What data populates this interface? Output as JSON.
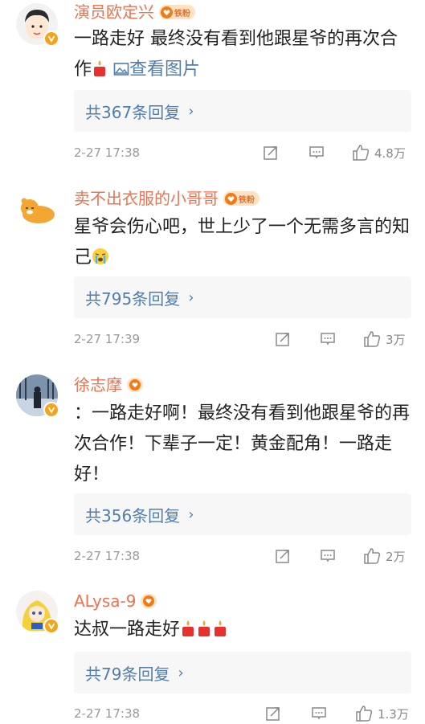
{
  "comments": [
    {
      "username": "演员欧定兴",
      "fan_badge": "铁粉",
      "verified": true,
      "text": "一路走好 最终没有看到他跟星爷的再次合作",
      "link": "查看图片",
      "replies": "共367条回复",
      "time": "2-27 17:38",
      "likes": "4.8万"
    },
    {
      "username": "卖不出衣服的小哥哥",
      "fan_badge": "铁粉",
      "verified": false,
      "text": "星爷会伤心吧，世上少了一个无需多言的知己",
      "replies": "共795条回复",
      "time": "2-27 17:39",
      "likes": "3万"
    },
    {
      "username": "徐志摩",
      "verified": true,
      "text": "：一路走好啊！最终没有看到他跟星爷的再次合作！下辈子一定！黄金配角！一路走好！",
      "replies": "共356条回复",
      "time": "2-27 17:38",
      "likes": "2万"
    },
    {
      "username": "ALysa-9",
      "verified": true,
      "text": "达叔一路走好",
      "replies": "共79条回复",
      "time": "2-27 17:38",
      "likes": "1.3万"
    }
  ],
  "icons": {
    "repost": "share-icon",
    "comment": "comment-icon",
    "like": "thumbs-up-icon",
    "image": "image-icon",
    "candle": "candle-emoji",
    "cry": "crying-emoji"
  },
  "colors": {
    "username": "#eb7350",
    "link": "#507daf",
    "meta": "#999999",
    "reply_bg": "#f7f7f7"
  }
}
